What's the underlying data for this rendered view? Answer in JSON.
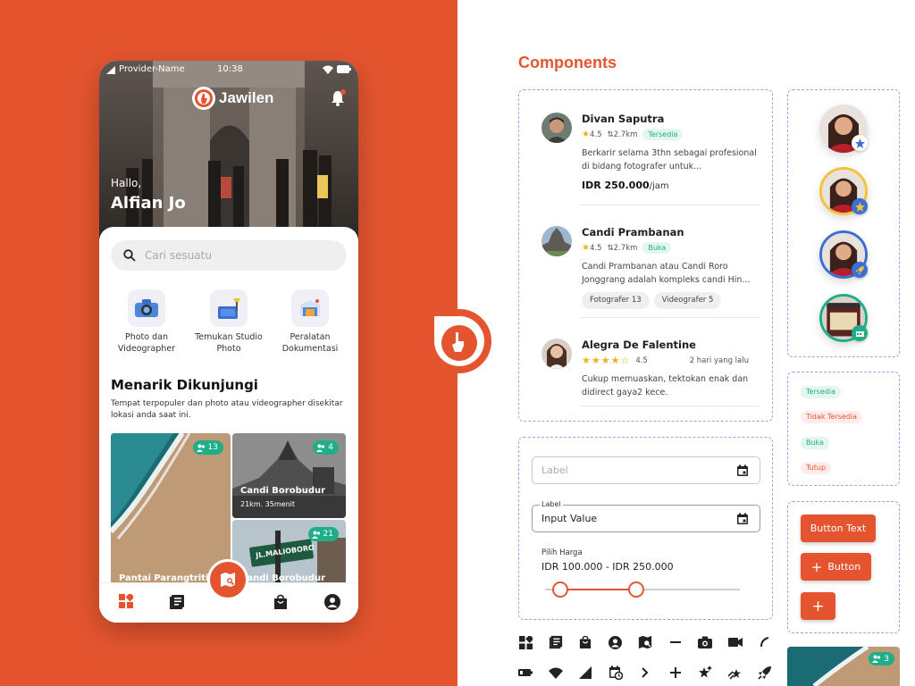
{
  "colors": {
    "brand": "#e4552f",
    "available": "#1fae87",
    "dashed": "#a79cf0"
  },
  "phone": {
    "status": {
      "carrier": "Provider-Name",
      "time": "10:38"
    },
    "brand": "Jawilen",
    "greeting": "Hallo,",
    "user_name": "Alfian Jo",
    "search_placeholder": "Cari sesuatu",
    "categories": [
      {
        "label": "Photo dan Videographer",
        "icon": "camera-icon"
      },
      {
        "label": "Temukan Studio Photo",
        "icon": "studio-icon"
      },
      {
        "label": "Peralatan Dokumentasi",
        "icon": "equipment-icon"
      }
    ],
    "section_title": "Menarik Dikunjungi",
    "section_desc": "Tempat terpopuler dan photo atau videographer disekitar lokasi anda saat ini.",
    "places": [
      {
        "title": "Pantai Parangtritis",
        "count": "13"
      },
      {
        "title": "Candi Borobudur",
        "subtitle": "21km. 35menit",
        "count": "4"
      },
      {
        "title": "Candi Borobudur",
        "count": "21",
        "sign": "JL.MALIOBORO"
      }
    ],
    "nav": [
      "home-icon",
      "articles-icon",
      "map-search-icon",
      "bag-icon",
      "profile-icon"
    ]
  },
  "components": {
    "title": "Components",
    "list": [
      {
        "name": "Divan Saputra",
        "rating": "4.5",
        "distance": "2.7km",
        "tag": "Tersedia",
        "desc": "Berkarir selama 3thn sebagai profesional di bidang fotografer untuk...",
        "price": "IDR 250.000",
        "unit": "/jam"
      },
      {
        "name": "Candi Prambanan",
        "rating": "4.5",
        "distance": "2.7km",
        "tag": "Buka",
        "desc": "Candi Prambanan atau Candi Roro Jonggrang adalah kompleks candi Hin...",
        "chips": [
          "Fotografer 13",
          "Videografer 5"
        ]
      },
      {
        "name": "Alegra De Falentine",
        "rating": "4.5",
        "time": "2 hari yang lalu",
        "desc": "Cukup memuaskan, tektokan enak dan didirect gaya2 kece."
      }
    ],
    "form": {
      "empty_label": "Label",
      "filled_label": "Label",
      "filled_value": "Input Value",
      "slider_label": "Pilih Harga",
      "slider_value": "IDR 100.000 - IDR 250.000",
      "slider_range": [
        0.08,
        0.47
      ]
    },
    "status_tags": [
      "Tersedia",
      "Tidak Tersedia",
      "Buka",
      "Tutup"
    ],
    "buttons": [
      "Button Text",
      "Button",
      "+"
    ],
    "thumb_count": "3",
    "icons_row1": [
      "grid-icon",
      "article-icon",
      "bag-icon",
      "account-icon",
      "map-search-icon",
      "minus-icon",
      "camera-icon",
      "video-icon",
      "arc-icon"
    ],
    "icons_row2": [
      "battery-icon",
      "wifi-icon",
      "signal-icon",
      "calendar-clock-icon",
      "chevron-right-icon",
      "plus-icon",
      "star-sparkle-icon",
      "shooting-star-icon",
      "rocket-icon"
    ]
  }
}
